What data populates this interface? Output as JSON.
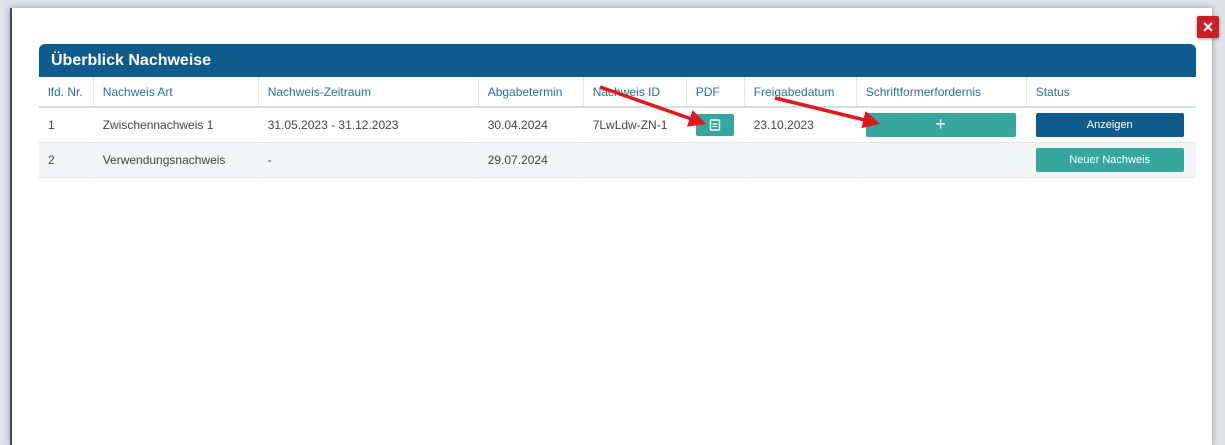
{
  "dialog": {
    "close_label": "×",
    "title": "Überblick Nachweise"
  },
  "table": {
    "columns": [
      "lfd. Nr.",
      "Nachweis Art",
      "Nachweis-Zeitraum",
      "Abgabetermin",
      "Nachweis ID",
      "PDF",
      "Freigabedatum",
      "Schriftformerfordernis",
      "Status"
    ],
    "rows": [
      {
        "nr": "1",
        "art": "Zwischennachweis 1",
        "zeitraum": "31.05.2023 - 31.12.2023",
        "abgabetermin": "30.04.2024",
        "nachweis_id": "7LwLdw-ZN-1",
        "freigabedatum": "23.10.2023",
        "schriftform_label": "+",
        "status_label": "Anzeigen"
      },
      {
        "nr": "2",
        "art": "Verwendungsnachweis",
        "zeitraum": "-",
        "abgabetermin": "29.07.2024",
        "nachweis_id": "",
        "freigabedatum": "",
        "schriftform_label": "",
        "status_label": "Neuer Nachweis"
      }
    ]
  },
  "icons": {
    "pdf": "pdf-file-icon",
    "close": "close-icon",
    "annotation": "red-arrow"
  },
  "colors": {
    "header": "#0f5c8c",
    "teal": "#35a79c",
    "close": "#c8202b",
    "arrow": "#e0191f"
  }
}
